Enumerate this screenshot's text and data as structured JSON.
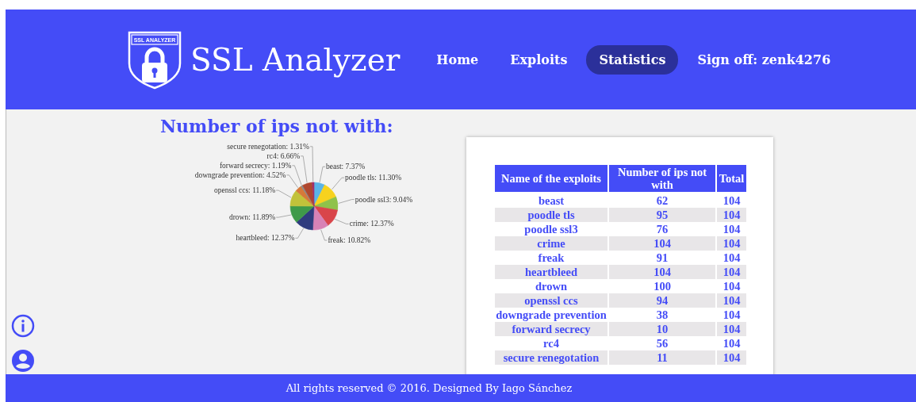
{
  "header": {
    "logo_text": "SSL ANALYZER",
    "title": "SSL Analyzer",
    "nav": [
      {
        "label": "Home",
        "selected": false
      },
      {
        "label": "Exploits",
        "selected": false
      },
      {
        "label": "Statistics",
        "selected": true
      },
      {
        "label": "Sign off: zenk4276",
        "selected": false
      }
    ]
  },
  "chart_section": {
    "title": "Number of ips not with:",
    "chart_data": {
      "type": "pie",
      "values": [
        7.37,
        11.3,
        9.04,
        12.37,
        10.82,
        12.37,
        11.89,
        11.18,
        4.52,
        1.19,
        6.66,
        1.31
      ],
      "value_labels": [
        "beast: 7.37%",
        "poodle tls: 11.30%",
        "poodle ssl3: 9.04%",
        "crime: 12.37%",
        "freak: 10.82%",
        "heartbleed: 12.37%",
        "drown: 11.89%",
        "openssl ccs: 11.18%",
        "downgrade prevention: 4.52%",
        "forward secrecy: 1.19%",
        "rc4: 6.66%",
        "secure renegotation: 1.31%"
      ],
      "colors": [
        "#5ab4e8",
        "#f7d21e",
        "#8fc24a",
        "#d9454a",
        "#d882b6",
        "#2f3c7e",
        "#3f9a49",
        "#c2c23a",
        "#d6793a",
        "#8a8a8a",
        "#b0472e",
        "#a12f68"
      ]
    }
  },
  "table": {
    "columns": [
      "Name of the exploits",
      "Number of ips not with",
      "Total"
    ],
    "rows": [
      [
        "beast",
        "62",
        "104"
      ],
      [
        "poodle tls",
        "95",
        "104"
      ],
      [
        "poodle ssl3",
        "76",
        "104"
      ],
      [
        "crime",
        "104",
        "104"
      ],
      [
        "freak",
        "91",
        "104"
      ],
      [
        "heartbleed",
        "104",
        "104"
      ],
      [
        "drown",
        "100",
        "104"
      ],
      [
        "openssl ccs",
        "94",
        "104"
      ],
      [
        "downgrade prevention",
        "38",
        "104"
      ],
      [
        "forward secrecy",
        "10",
        "104"
      ],
      [
        "rc4",
        "56",
        "104"
      ],
      [
        "secure renegotation",
        "11",
        "104"
      ]
    ]
  },
  "footer": {
    "text": "All rights reserved © 2016. Designed By Iago Sánchez"
  }
}
